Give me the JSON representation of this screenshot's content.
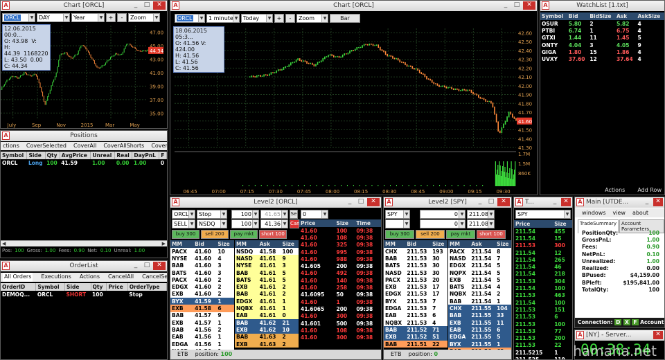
{
  "title_icon": "A",
  "chart1": {
    "title": "Chart [ORCL]",
    "symbol": "ORCL",
    "period": "DAY",
    "range": "Year",
    "zoom": "Zoom",
    "info": {
      "date": "12.06.2015 00:0...",
      "o": "O: 43.98",
      "v": "V:",
      "h": "H: 44.39",
      "vv": "1168220",
      "l": "L: 43.50",
      "l2": "0.00",
      "c": "C: 44.34"
    },
    "yticks": [
      "47.00",
      "45.00",
      "43.00",
      "41.00",
      "39.00",
      "37.00",
      "35.00"
    ],
    "price_tag": "44.34",
    "xticks": [
      "July",
      "Sep",
      "Nov",
      "2015",
      "Mar",
      "May"
    ],
    "price_path": [
      [
        0,
        38.5
      ],
      [
        0.04,
        39.8
      ],
      [
        0.08,
        40.5
      ],
      [
        0.12,
        40.2
      ],
      [
        0.16,
        41
      ],
      [
        0.2,
        40.5
      ],
      [
        0.24,
        40.8
      ],
      [
        0.27,
        38.8
      ],
      [
        0.3,
        36.2
      ],
      [
        0.32,
        37.4
      ],
      [
        0.35,
        39.4
      ],
      [
        0.38,
        41
      ],
      [
        0.4,
        43.6
      ],
      [
        0.44,
        44
      ],
      [
        0.48,
        43.1
      ],
      [
        0.52,
        43.8
      ],
      [
        0.55,
        45.2
      ],
      [
        0.58,
        44.6
      ],
      [
        0.62,
        43.1
      ],
      [
        0.66,
        41.6
      ],
      [
        0.7,
        42.1
      ],
      [
        0.74,
        43.1
      ],
      [
        0.78,
        43.8
      ],
      [
        0.82,
        43.6
      ],
      [
        0.86,
        45.4
      ],
      [
        0.9,
        44.8
      ],
      [
        0.94,
        44.2
      ],
      [
        1,
        44.3
      ]
    ],
    "ylim": [
      34,
      48
    ]
  },
  "chart2": {
    "title": "Chart [ORCL]",
    "symbol": "ORCL",
    "interval": "1 minute",
    "range": "Today",
    "zoom": "Zoom",
    "type_btn": "Bar",
    "info": {
      "date": "18.06.2015 05:3...",
      "o": "O: 41.56",
      "v": "V: 424.00",
      "h": "H: 41.56",
      "l": "L: 41.56",
      "c": "C: 41.56"
    },
    "yticks": [
      "42.60",
      "42.50",
      "42.40",
      "42.30",
      "42.20",
      "42.10",
      "42.00",
      "41.90",
      "41.80",
      "41.70",
      "41.60",
      "41.50",
      "41.40",
      "41.30"
    ],
    "price_tag": "41.60",
    "vol_ticks": [
      "1.7M",
      "1.5M",
      "860K"
    ],
    "xticks": [
      "06:45",
      "07:00",
      "07:15",
      "07:30",
      "07:45",
      "08:00",
      "08:15",
      "08:30",
      "08:45",
      "09:00",
      "09:15",
      "09:30"
    ],
    "price_path": [
      [
        0.22,
        42.1
      ],
      [
        0.27,
        42.12
      ],
      [
        0.32,
        42.2
      ],
      [
        0.36,
        42.3
      ],
      [
        0.41,
        42.23
      ],
      [
        0.45,
        42.35
      ],
      [
        0.48,
        42.32
      ],
      [
        0.52,
        42.4
      ],
      [
        0.56,
        42.47
      ],
      [
        0.59,
        42.46
      ],
      [
        0.62,
        42.35
      ],
      [
        0.65,
        42.3
      ],
      [
        0.68,
        42.23
      ],
      [
        0.71,
        42.18
      ],
      [
        0.74,
        42.08
      ],
      [
        0.77,
        42.0
      ],
      [
        0.8,
        41.98
      ],
      [
        0.83,
        41.95
      ],
      [
        0.86,
        41.95
      ],
      [
        0.88,
        41.9
      ],
      [
        0.9,
        41.85
      ],
      [
        0.93,
        41.8
      ],
      [
        0.95,
        41.45
      ],
      [
        0.98,
        41.7
      ],
      [
        1.0,
        41.6
      ]
    ],
    "ylim": [
      41.3,
      42.65
    ]
  },
  "watchlist": {
    "title": "WatchList [1.txt]",
    "cols": [
      "Symbol",
      "Bid",
      "BidSize",
      "Ask",
      "AskSize"
    ],
    "rows": [
      [
        "OSUR",
        "5.80",
        "2",
        "5.82",
        "4"
      ],
      [
        "PTBI",
        "6.74",
        "1",
        "6.75",
        "4"
      ],
      [
        "GTXI",
        "1.44",
        "11",
        "1.45",
        "5"
      ],
      [
        "ONTY",
        "4.04",
        "3",
        "4.05",
        "9"
      ],
      [
        "GIGA",
        "1.80",
        "15",
        "1.86",
        "4"
      ],
      [
        "UVXY",
        "37.60",
        "12",
        "37.64",
        "4"
      ]
    ],
    "actions": "Actions",
    "add_row": "Add Row"
  },
  "positions": {
    "title": "Positions",
    "menu": [
      "ctions",
      "CoverSelected",
      "CoverAll",
      "CoverAllShorts",
      "CoverAllLongs"
    ],
    "cols": [
      "Symbol",
      "Side",
      "Qty",
      "AvgPrice",
      "Unreal",
      "Real",
      "DayPnL",
      "F"
    ],
    "row": [
      "ORCL",
      "Long",
      "100",
      "41.59",
      "1.00",
      "0.00",
      "1.00",
      "0"
    ],
    "footer": {
      "pos_label": "Pos:",
      "pos": "100",
      "gross_label": "Gross:",
      "gross": "1.00",
      "fees_label": "Fees:",
      "fees": "0.90",
      "net_label": "Net:",
      "net": "0.10",
      "unreal_label": "Unreal:",
      "unreal": "1.00"
    }
  },
  "orderlist": {
    "title": "OrderList",
    "tabs": [
      "All Orders",
      "Executions",
      "Actions",
      "CancelAll",
      "CancelSelected"
    ],
    "cols": [
      "OrderID",
      "Symbol",
      "Side",
      "Qty",
      "Price",
      "OrderType"
    ],
    "row": [
      "DEMOQ...",
      "ORCL",
      "SHORT",
      "100",
      "",
      "Stop"
    ]
  },
  "l2orcl": {
    "title": "Level2 [ORCL]",
    "type": "Stop",
    "qty1": "100",
    "px1": "41.65",
    "se": "Se",
    "side": "SELL",
    "route": "NSDQ",
    "qty2": "100",
    "px2": "41.36",
    "can": "Can",
    "b1": "buy 300 bid",
    "b2": "sell 200 mkt",
    "b3": "pay mkt",
    "b4": "short 100",
    "tsqty": "0",
    "bid_cols": [
      "MM",
      "Bid",
      "Size"
    ],
    "ask_cols": [
      "MM",
      "Ask",
      "Size"
    ],
    "bids": [
      [
        "PACX",
        "41.60",
        "10"
      ],
      [
        "NYSE",
        "41.60",
        "4"
      ],
      [
        "BAB",
        "41.60",
        "3"
      ],
      [
        "BATS",
        "41.60",
        "3"
      ],
      [
        "PACX",
        "41.60",
        "2"
      ],
      [
        "EDGX",
        "41.60",
        "2"
      ],
      [
        "EXB",
        "41.60",
        "2"
      ],
      [
        "BYX",
        "41.59",
        "1"
      ],
      [
        "EXB",
        "41.58",
        "6"
      ],
      [
        "BAB",
        "41.57",
        "9"
      ],
      [
        "EXB",
        "41.57",
        "1"
      ],
      [
        "BAB",
        "41.56",
        "2"
      ],
      [
        "EAB",
        "41.56",
        "1"
      ],
      [
        "EDGA",
        "41.56",
        "1"
      ],
      [
        "NASD",
        "41.56",
        "1"
      ],
      [
        "EXB",
        "41.55",
        "17"
      ]
    ],
    "asks": [
      [
        "NSDQ",
        "41.58",
        "100"
      ],
      [
        "NASD",
        "41.61",
        "9"
      ],
      [
        "NYSE",
        "41.61",
        "3"
      ],
      [
        "BAB",
        "41.61",
        "5"
      ],
      [
        "BATS",
        "41.61",
        "5"
      ],
      [
        "EXB",
        "41.61",
        "2"
      ],
      [
        "BAB",
        "41.61",
        "2"
      ],
      [
        "EDGX",
        "41.61",
        "1"
      ],
      [
        "NQBX",
        "41.61",
        "1"
      ],
      [
        "EAB",
        "41.61",
        "0"
      ],
      [
        "BAB",
        "41.62",
        "21"
      ],
      [
        "EXB",
        "41.62",
        "10"
      ],
      [
        "BAB",
        "41.63",
        "2"
      ],
      [
        "EXB",
        "41.63",
        "2"
      ]
    ],
    "ts_cols": [
      "Price",
      "Size",
      "Time"
    ],
    "ts": [
      [
        "41.60",
        "100",
        "09:38"
      ],
      [
        "41.60",
        "108",
        "09:38"
      ],
      [
        "41.60",
        "325",
        "09:38"
      ],
      [
        "41.60",
        "995",
        "09:38"
      ],
      [
        "41.60",
        "988",
        "09:38"
      ],
      [
        "41.605",
        "200",
        "09:38"
      ],
      [
        "41.60",
        "492",
        "09:38"
      ],
      [
        "41.60",
        "140",
        "09:38"
      ],
      [
        "41.60",
        "258",
        "09:38"
      ],
      [
        "41.6095",
        "50",
        "09:38"
      ],
      [
        "41.60",
        "1",
        "09:38"
      ],
      [
        "41.6065",
        "200",
        "09:38"
      ],
      [
        "41.60",
        "300",
        "09:38"
      ],
      [
        "41.601",
        "500",
        "09:38"
      ],
      [
        "41.60",
        "108",
        "09:38"
      ],
      [
        "41.60",
        "300",
        "09:38"
      ]
    ],
    "ts_white": [
      5,
      9,
      11,
      13
    ],
    "foot_sym": "ETB",
    "foot_pos_label": "position:",
    "foot_pos": "100"
  },
  "l2spy": {
    "title": "Level2 [SPY]",
    "symbol": "SPY",
    "qtyA": "0",
    "pxA": "211.08",
    "qtyB": "0",
    "pxB": "211.08",
    "b1": "buy 300 bid",
    "b2": "sell 200 mkt",
    "b3": "pay mkt",
    "b4": "short 100",
    "bid_cols": [
      "MM",
      "Bid",
      "Size"
    ],
    "ask_cols": [
      "MM",
      "Ask",
      "Size"
    ],
    "bids": [
      [
        "CHX",
        "211.53",
        "193"
      ],
      [
        "BAB",
        "211.53",
        "30"
      ],
      [
        "BATS",
        "211.53",
        "30"
      ],
      [
        "NASD",
        "211.53",
        "30"
      ],
      [
        "PACX",
        "211.53",
        "20"
      ],
      [
        "EXB",
        "211.53",
        "17"
      ],
      [
        "EDGX",
        "211.53",
        "17"
      ],
      [
        "BYX",
        "211.53",
        "7"
      ],
      [
        "EDGA",
        "211.53",
        "7"
      ],
      [
        "EAB",
        "211.53",
        "6"
      ],
      [
        "NQBX",
        "211.53",
        "4"
      ],
      [
        "BAB",
        "211.52",
        "71"
      ],
      [
        "EXB",
        "211.52",
        "51"
      ],
      [
        "BAB",
        "211.51",
        "22"
      ]
    ],
    "asks": [
      [
        "PACX",
        "211.54",
        "8"
      ],
      [
        "NASD",
        "211.54",
        "7"
      ],
      [
        "EDGX",
        "211.54",
        "5"
      ],
      [
        "NQPX",
        "211.54",
        "5"
      ],
      [
        "EXB",
        "211.54",
        "5"
      ],
      [
        "BATS",
        "211.54",
        "4"
      ],
      [
        "NQBX",
        "211.54",
        "2"
      ],
      [
        "BAB",
        "211.54",
        "1"
      ],
      [
        "CHX",
        "211.55",
        "104"
      ],
      [
        "BAB",
        "211.55",
        "33"
      ],
      [
        "EXB",
        "211.55",
        "11"
      ],
      [
        "EAB",
        "211.55",
        "6"
      ],
      [
        "EDGA",
        "211.55",
        "5"
      ],
      [
        "BYX",
        "211.55",
        "1"
      ],
      [
        "BAB",
        "211.56",
        "62"
      ]
    ],
    "foot_sym": "ETB",
    "foot_pos_label": "position:",
    "foot_pos": "0"
  },
  "spyts": {
    "title": "T...",
    "symbol": "SPY",
    "cols": [
      "Price",
      "Size"
    ],
    "rows": [
      [
        "211.54",
        "455"
      ],
      [
        "211.54",
        "15"
      ],
      [
        "211.53",
        "300"
      ],
      [
        "211.54",
        "12"
      ],
      [
        "211.54",
        "265"
      ],
      [
        "211.54",
        "46"
      ],
      [
        "211.54",
        "218"
      ],
      [
        "211.53",
        "304"
      ],
      [
        "211.54",
        "100"
      ],
      [
        "211.53",
        "463"
      ],
      [
        "211.54",
        "100"
      ],
      [
        "211.53",
        "151"
      ],
      [
        "211.53",
        "6"
      ],
      [
        "211.53",
        "100"
      ],
      [
        "211.53",
        "77"
      ],
      [
        "211.53",
        "200"
      ],
      [
        "211.53",
        "22"
      ],
      [
        "211.5215",
        "1"
      ],
      [
        "211.525",
        "119"
      ]
    ],
    "red": [
      2
    ]
  },
  "main": {
    "title": "Main [UTDE...",
    "menu": [
      "windows",
      "view",
      "about"
    ],
    "tabs": [
      "TradeSummary",
      "Account Parameters"
    ],
    "rows": [
      [
        "PositionQty:",
        "100"
      ],
      [
        "GrossPnL:",
        "1.00"
      ],
      [
        "Fees:",
        "0.90"
      ],
      [
        "NetPnL:",
        "0.10"
      ],
      [
        "Unrealized:",
        "1.00"
      ],
      [
        "Realized:",
        "0.00"
      ],
      [
        "BPused:",
        "$4,159.00"
      ],
      [
        "BPleft:",
        "$195,841.00"
      ],
      [
        "TotalQty:",
        "100"
      ]
    ],
    "conn_label": "Connection:",
    "conn": [
      "D",
      "X",
      "F"
    ],
    "acct_status": "AccountSta"
  },
  "server": {
    "title": "[NY] - Server...",
    "clock": "00:38:34"
  },
  "watermark": "hamaha.net"
}
